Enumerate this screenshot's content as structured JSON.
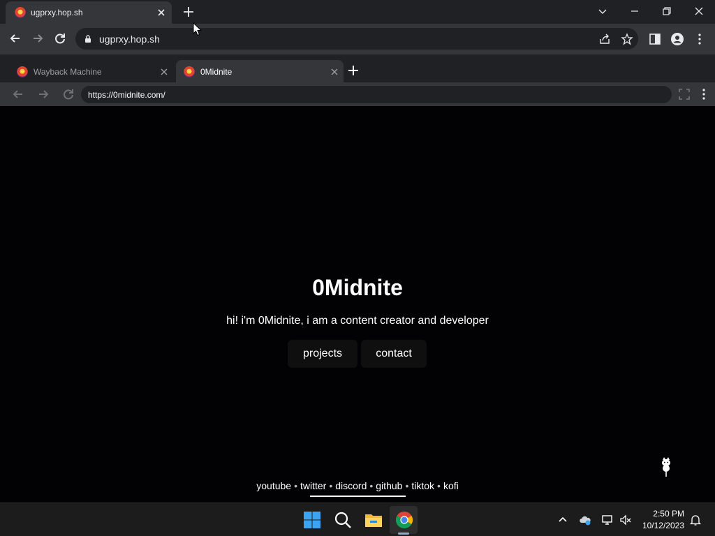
{
  "outer_browser": {
    "tab_title": "ugprxy.hop.sh",
    "url": "ugprxy.hop.sh"
  },
  "inner_browser": {
    "tabs": [
      {
        "title": "Wayback Machine"
      },
      {
        "title": "0Midnite"
      }
    ],
    "url": "https://0midnite.com/"
  },
  "page": {
    "title": "0Midnite",
    "subtitle": "hi! i'm 0Midnite, i am a content creator and developer",
    "buttons": {
      "projects": "projects",
      "contact": "contact"
    },
    "footer_links": [
      {
        "label": "youtube"
      },
      {
        "label": "twitter"
      },
      {
        "label": "discord"
      },
      {
        "label": "github"
      },
      {
        "label": "tiktok"
      },
      {
        "label": "kofi"
      }
    ],
    "footer_separator": "•"
  },
  "taskbar": {
    "time": "2:50 PM",
    "date": "10/12/2023"
  },
  "colors": {
    "page_bg": "#020204",
    "chrome_dark": "#202124",
    "chrome_toolbar": "#35363a",
    "taskbar_bg": "#1c1c1c"
  }
}
